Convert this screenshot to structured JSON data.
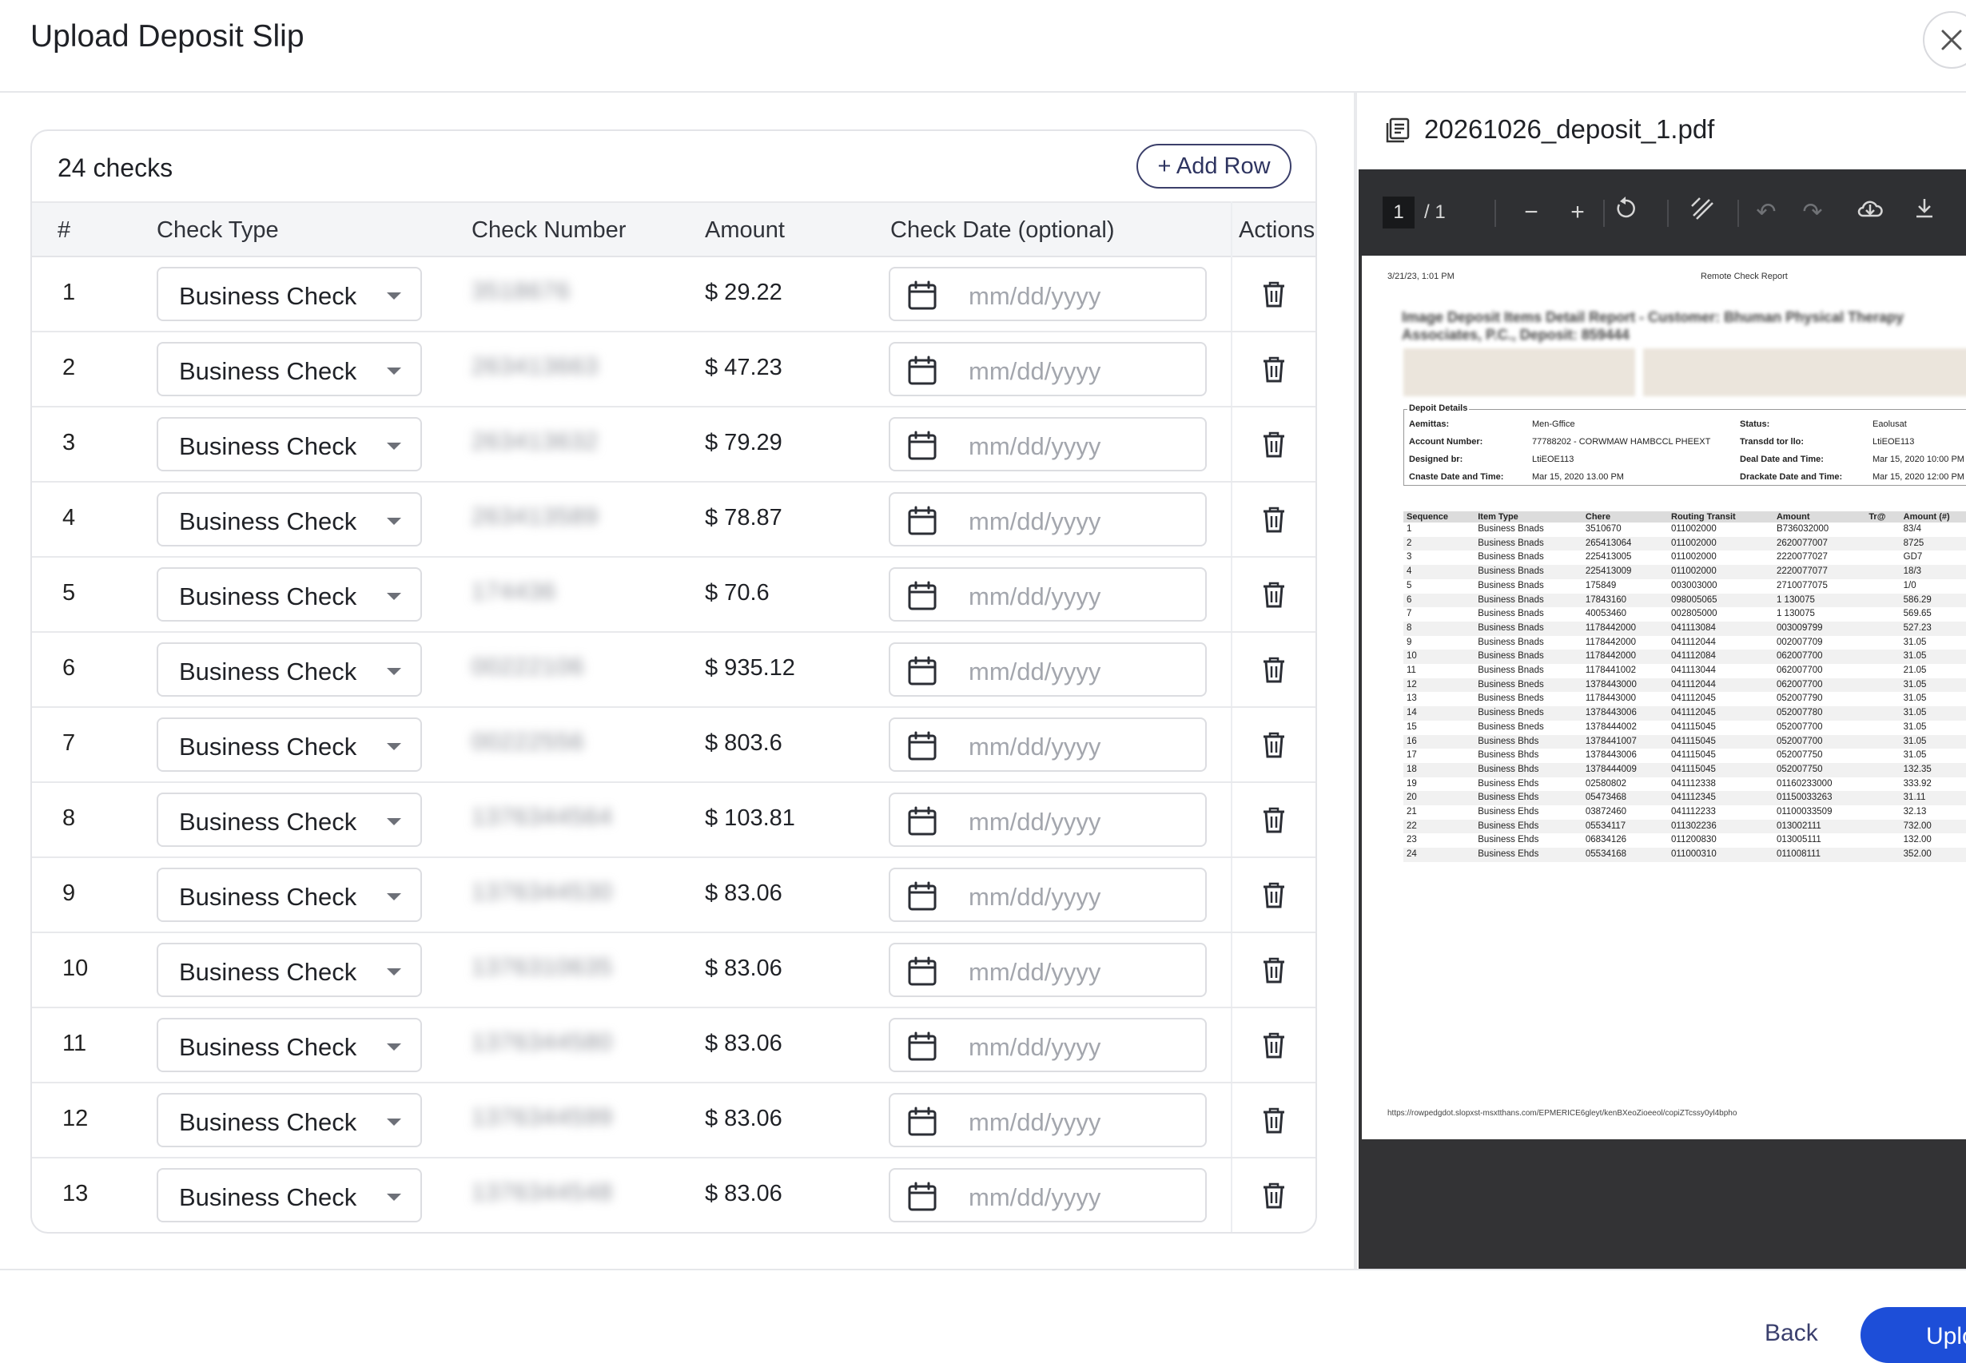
{
  "header": {
    "title": "Upload Deposit Slip"
  },
  "checks_panel": {
    "count_label": "24 checks",
    "add_row_label": "+ Add Row",
    "columns": [
      "#",
      "Check Type",
      "Check Number",
      "Amount",
      "Check Date (optional)",
      "Actions"
    ],
    "rows": [
      {
        "num": "1",
        "type": "Business Check",
        "check_number": "3518676",
        "amount": "$  29.22",
        "date_placeholder": "mm/dd/yyyy"
      },
      {
        "num": "2",
        "type": "Business Check",
        "check_number": "263413663",
        "amount": "$  47.23",
        "date_placeholder": "mm/dd/yyyy"
      },
      {
        "num": "3",
        "type": "Business Check",
        "check_number": "263413632",
        "amount": "$  79.29",
        "date_placeholder": "mm/dd/yyyy"
      },
      {
        "num": "4",
        "type": "Business Check",
        "check_number": "263413589",
        "amount": "$  78.87",
        "date_placeholder": "mm/dd/yyyy"
      },
      {
        "num": "5",
        "type": "Business Check",
        "check_number": "174436",
        "amount": "$  70.6",
        "date_placeholder": "mm/dd/yyyy"
      },
      {
        "num": "6",
        "type": "Business Check",
        "check_number": "00222106",
        "amount": "$  935.12",
        "date_placeholder": "mm/dd/yyyy"
      },
      {
        "num": "7",
        "type": "Business Check",
        "check_number": "00222556",
        "amount": "$  803.6",
        "date_placeholder": "mm/dd/yyyy"
      },
      {
        "num": "8",
        "type": "Business Check",
        "check_number": "1376344564",
        "amount": "$  103.81",
        "date_placeholder": "mm/dd/yyyy"
      },
      {
        "num": "9",
        "type": "Business Check",
        "check_number": "1376344530",
        "amount": "$  83.06",
        "date_placeholder": "mm/dd/yyyy"
      },
      {
        "num": "10",
        "type": "Business Check",
        "check_number": "1376310635",
        "amount": "$  83.06",
        "date_placeholder": "mm/dd/yyyy"
      },
      {
        "num": "11",
        "type": "Business Check",
        "check_number": "1376344580",
        "amount": "$  83.06",
        "date_placeholder": "mm/dd/yyyy"
      },
      {
        "num": "12",
        "type": "Business Check",
        "check_number": "1376344599",
        "amount": "$  83.06",
        "date_placeholder": "mm/dd/yyyy"
      },
      {
        "num": "13",
        "type": "Business Check",
        "check_number": "1376344548",
        "amount": "$  83.06",
        "date_placeholder": "mm/dd/yyyy"
      }
    ]
  },
  "preview": {
    "file_name": "20261026_deposit_1.pdf",
    "page_current": "1",
    "page_total": "/  1",
    "pdf": {
      "date": "3/21/23, 1:01 PM",
      "report_title": "Remote Check Report",
      "heading": "Image Deposit Items Detail Report - Customer: Bhuman Physical Therapy Associates, P.C., Deposit: 859444",
      "details_title": "Depoit Details",
      "details": [
        {
          "label": "Aemittas:",
          "value": "Men-Gffice"
        },
        {
          "label": "Account Number:",
          "value": "77788202 - CORWMAW HAMBCCL PHEEXT"
        },
        {
          "label": "Designed br:",
          "value": "LtiEOE113"
        },
        {
          "label": "Cnaste Date and Time:",
          "value": "Mar 15, 2020 13.00 PM"
        },
        {
          "label": "Status:",
          "value": "Eaolusat"
        },
        {
          "label": "Transdd tor llo:",
          "value": "LtiEOE113"
        },
        {
          "label": "Deal Date and Time:",
          "value": "Mar 15, 2020 10:00 PM"
        },
        {
          "label": "Drackate Date and Time:",
          "value": "Mar 15, 2020 12:00 PM"
        }
      ],
      "table_headers": [
        "Sequence",
        "Item Type",
        "Chere",
        "Routing Transit",
        "Amount",
        "Tr@",
        "Amount (#)"
      ],
      "table_rows": [
        [
          "1",
          "Business Bnads",
          "3510670",
          "011002000",
          "B736032000",
          "",
          "83/4"
        ],
        [
          "2",
          "Business Bnads",
          "265413064",
          "011002000",
          "2620077007",
          "",
          "8725"
        ],
        [
          "3",
          "Business Bnads",
          "225413005",
          "011002000",
          "2220077027",
          "",
          "GD7"
        ],
        [
          "4",
          "Business Bnads",
          "225413009",
          "011002000",
          "2220077077",
          "",
          "18/3"
        ],
        [
          "5",
          "Business Bnads",
          "175849",
          "003003000",
          "2710077075",
          "",
          "1/0"
        ],
        [
          "6",
          "Business Bnads",
          "17843160",
          "098005065",
          "1 130075",
          "",
          "586.29"
        ],
        [
          "7",
          "Business Bnads",
          "40053460",
          "002805000",
          "1 130075",
          "",
          "569.65"
        ],
        [
          "8",
          "Business Bnads",
          "1178442000",
          "041113084",
          "003009799",
          "",
          "527.23"
        ],
        [
          "9",
          "Business Bnads",
          "1178442000",
          "041112044",
          "002007709",
          "",
          "31.05"
        ],
        [
          "10",
          "Business Bnads",
          "1178442000",
          "041112084",
          "062007700",
          "",
          "31.05"
        ],
        [
          "11",
          "Business Bnads",
          "1178441002",
          "041113044",
          "062007700",
          "",
          "21.05"
        ],
        [
          "12",
          "Business Bneds",
          "1378443000",
          "041112044",
          "062007700",
          "",
          "31.05"
        ],
        [
          "13",
          "Business Bneds",
          "1178443000",
          "041112045",
          "052007790",
          "",
          "31.05"
        ],
        [
          "14",
          "Business Bneds",
          "1378443006",
          "041112045",
          "052007780",
          "",
          "31.05"
        ],
        [
          "15",
          "Business Bneds",
          "1378444002",
          "041115045",
          "052007700",
          "",
          "31.05"
        ],
        [
          "16",
          "Business Bhds",
          "1378441007",
          "041115045",
          "052007700",
          "",
          "31.05"
        ],
        [
          "17",
          "Business Bhds",
          "1378443006",
          "041115045",
          "052007750",
          "",
          "31.05"
        ],
        [
          "18",
          "Business Bhds",
          "1378444009",
          "041115045",
          "052007750",
          "",
          "132.35"
        ],
        [
          "19",
          "Business Ehds",
          "02580802",
          "041112338",
          "01160233000",
          "",
          "333.92"
        ],
        [
          "20",
          "Business Ehds",
          "05473468",
          "041112345",
          "01150033263",
          "",
          "31.11"
        ],
        [
          "21",
          "Business Ehds",
          "03872460",
          "041112233",
          "01100033509",
          "",
          "32.13"
        ],
        [
          "22",
          "Business Ehds",
          "05534117",
          "011302236",
          "013002111",
          "",
          "732.00"
        ],
        [
          "23",
          "Business Ehds",
          "06834126",
          "011200830",
          "013005111",
          "",
          "132.00"
        ],
        [
          "24",
          "Business Ehds",
          "05534168",
          "011000310",
          "011008111",
          "",
          "352.00"
        ]
      ],
      "url": "https://rowpedgdot.slopxst-msxtthans.com/EPMERICE6gleyt/kenBXeoZioeeol/copiZTcssy0yl4bpho"
    }
  },
  "footer": {
    "back_label": "Back",
    "upload_label": "Upload"
  }
}
